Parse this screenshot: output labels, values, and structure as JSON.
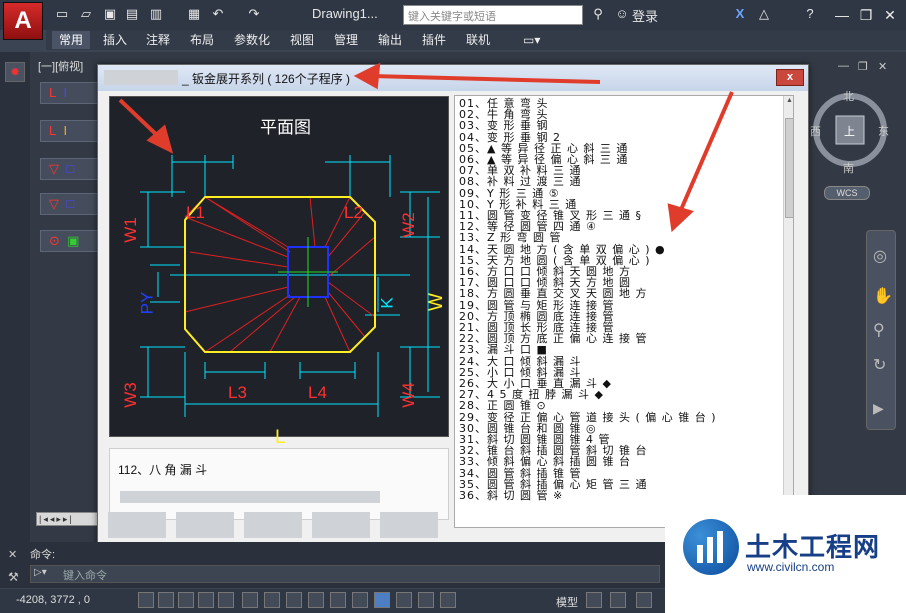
{
  "titlebar": {
    "logo": "A",
    "doc_title": "Drawing1...",
    "search_placeholder": "键入关键字或短语",
    "login": "登录"
  },
  "ribbon": {
    "tabs": [
      "常用",
      "插入",
      "注释",
      "布局",
      "参数化",
      "视图",
      "管理",
      "输出",
      "插件",
      "联机"
    ]
  },
  "viewport": {
    "label": "[一][俯视]",
    "compass": {
      "north": "北",
      "south": "南",
      "east": "东",
      "west": "西",
      "center": "上",
      "wcs": "WCS"
    }
  },
  "dialog": {
    "title": "_ 钣金展开系列 ( 126个子程序 )",
    "close": "x",
    "preview": {
      "title": "平面图",
      "labels": {
        "L1": "L1",
        "L2": "L2",
        "L3": "L3",
        "L4": "L4",
        "L": "L",
        "W": "W",
        "W1": "W1",
        "W2": "W2",
        "W3": "W3",
        "W4": "W4",
        "K": "K",
        "PY": "PY"
      }
    },
    "description": "112、八 角 漏 斗",
    "list_items": [
      "01、任 意 弯 头",
      "02、牛 角 弯 头",
      "03、变 形 垂 钢",
      "04、变 形 垂 钢 2",
      "05、▲ 等 异 径 正 心 斜 三 通",
      "06、▲ 等 异 径 偏 心 斜 三 通",
      "07、单 双 补 料 三 通",
      "08、补 料 过 渡 三 通",
      "09、Y 形 三 通  ⑤",
      "10、Y 形 补 料 三 通",
      "11、圆 管 变 径 锥 叉 形 三 通  §",
      "12、等 径 圆 管 四 通  ④",
      "13、Z 形 弯 圆 管",
      "14、天 圆 地 方 ( 含 单 双 偏 心 ) ●",
      "15、天 方 地 圆 ( 含 单 双 偏 心 )",
      "16、方 口 口 倾 斜 天 圆 地 方",
      "17、圆 口 口 倾 斜 天 方 地 圆",
      "18、方 圆 垂 直 交 叉 天 圆 地 方",
      "19、圆 管 与 矩 形 连 接 管",
      "20、方 顶 椭 圆 底 连 接 管",
      "21、圆 顶 长 形 底 连 接 管",
      "22、圆 顶 方 底 正 偏 心 连 接 管",
      "23、漏 斗 口 ■",
      "24、大 口 倾 斜 漏 斗",
      "25、小 口 倾 斜 漏 斗",
      "26、大 小 口 垂 直 漏 斗  ◆",
      "27、4 5 度 扭 脖 漏 斗  ◆",
      "28、正 圆 锥  ⊙",
      "29、变 径 正 偏 心 管 道 接 头 ( 偏 心 锥 台 )",
      "30、圆 锥 台 和 圆 锥  ◎",
      "31、斜 切 圆 锥 圆 锥 4 管",
      "32、锥 台 斜 插 圆 管 斜 切 锥 台",
      "33、倾 斜 偏 心 斜 插 圆 锥 台",
      "34、圆 管 斜 插 锥 管",
      "35、圆 管 斜 插 偏 心 矩 管 三 通",
      "36、斜 切 圆 管  ※"
    ]
  },
  "command": {
    "label": "命令:",
    "placeholder": "键入命令"
  },
  "status": {
    "coords": "-4208, 3772 , 0",
    "model": "模型"
  },
  "watermark": {
    "name": "土木工程网",
    "url": "www.civilcn.com"
  },
  "colors": {
    "accent_red": "#e03c2c",
    "cad_cyan": "#00e5ff",
    "cad_yellow": "#ffee22",
    "cad_blue": "#2030ff"
  }
}
